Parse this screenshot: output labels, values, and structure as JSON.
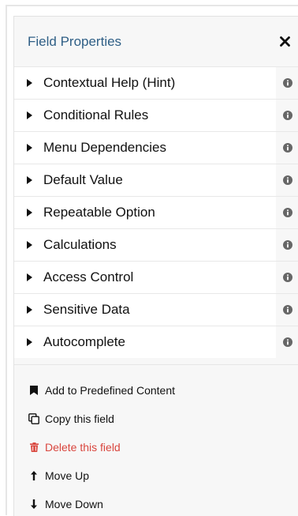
{
  "panel": {
    "title": "Field Properties",
    "close_icon": "close-icon"
  },
  "sections": [
    {
      "label": "Contextual Help (Hint)"
    },
    {
      "label": "Conditional Rules"
    },
    {
      "label": "Menu Dependencies"
    },
    {
      "label": "Default Value"
    },
    {
      "label": "Repeatable Option"
    },
    {
      "label": "Calculations"
    },
    {
      "label": "Access Control"
    },
    {
      "label": "Sensitive Data"
    },
    {
      "label": "Autocomplete"
    }
  ],
  "actions": [
    {
      "label": "Add to Predefined Content",
      "icon": "bookmark-icon"
    },
    {
      "label": "Copy this field",
      "icon": "copy-icon"
    },
    {
      "label": "Delete this field",
      "icon": "trash-icon",
      "color": "#d9463e"
    },
    {
      "label": "Move Up",
      "icon": "arrow-up-icon"
    },
    {
      "label": "Move Down",
      "icon": "arrow-down-icon"
    }
  ],
  "colors": {
    "title": "#2f5f86",
    "danger": "#d9463e",
    "panel_bg": "#f7f7f7"
  }
}
